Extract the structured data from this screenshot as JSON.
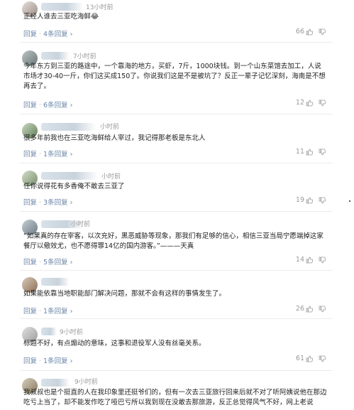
{
  "comments": [
    {
      "time": "13小时前",
      "text": "正经人谁去三亚吃海鲜😂",
      "reply": "回复",
      "replies": "4条回复",
      "likes": "66"
    },
    {
      "time": "7小时前",
      "text": "今年东方到三亚的路途中，一个靠海的地方，买虾，7斤，1000块钱。到一个山东菜馆去加工，人说市场才30-40一斤，你们这买成150了。你说我们这是不是被坑了？反正一辈子记忆深刻，海南是不想再去了。",
      "reply": "回复",
      "replies": "6条回复",
      "likes": "12"
    },
    {
      "time": "小时前",
      "text": "很多年前我也在三亚吃海鲜给人宰过，我记得那老板是东北人",
      "reply": "回复",
      "replies": "1条回复",
      "likes": "11"
    },
    {
      "time": "小时前",
      "text": "任你说得花有多香俺不敢去三亚了",
      "reply": "回复",
      "replies": "3条回复",
      "likes": "19"
    },
    {
      "time": "小时前",
      "text": "“如果真的存在宰客，以次充好，黑恶威胁等现象，那我们有足够的信心，相信三亚当局宁愿端掉这家餐厅以儆效尤，也不愿得罪14亿的国内游客。”———天真",
      "reply": "回复",
      "replies": "5条回复",
      "likes": "14"
    },
    {
      "time": "",
      "text": "如果能依靠当地职能部门解决问题，那就不会有这样的事情发生了。",
      "reply": "回复",
      "replies": "1条回复",
      "likes": "26"
    },
    {
      "time": "9小时前",
      "text": "标题不好，有点煽动的意味，这事和退役军人没有丝毫关系。",
      "reply": "回复",
      "replies": "1条回复",
      "likes": "61"
    },
    {
      "time": "9小时前",
      "text": "我叔叔也是个挺直的人在我印象里还挺爷们的，但有一次去三亚旅行回来后就不对了听阿姨说他在那边吃亏上当了，却不能发作吃了哑巴亏所以我到现在没敢去那旅游，反正总觉得风气不好，网上老说"
    }
  ]
}
